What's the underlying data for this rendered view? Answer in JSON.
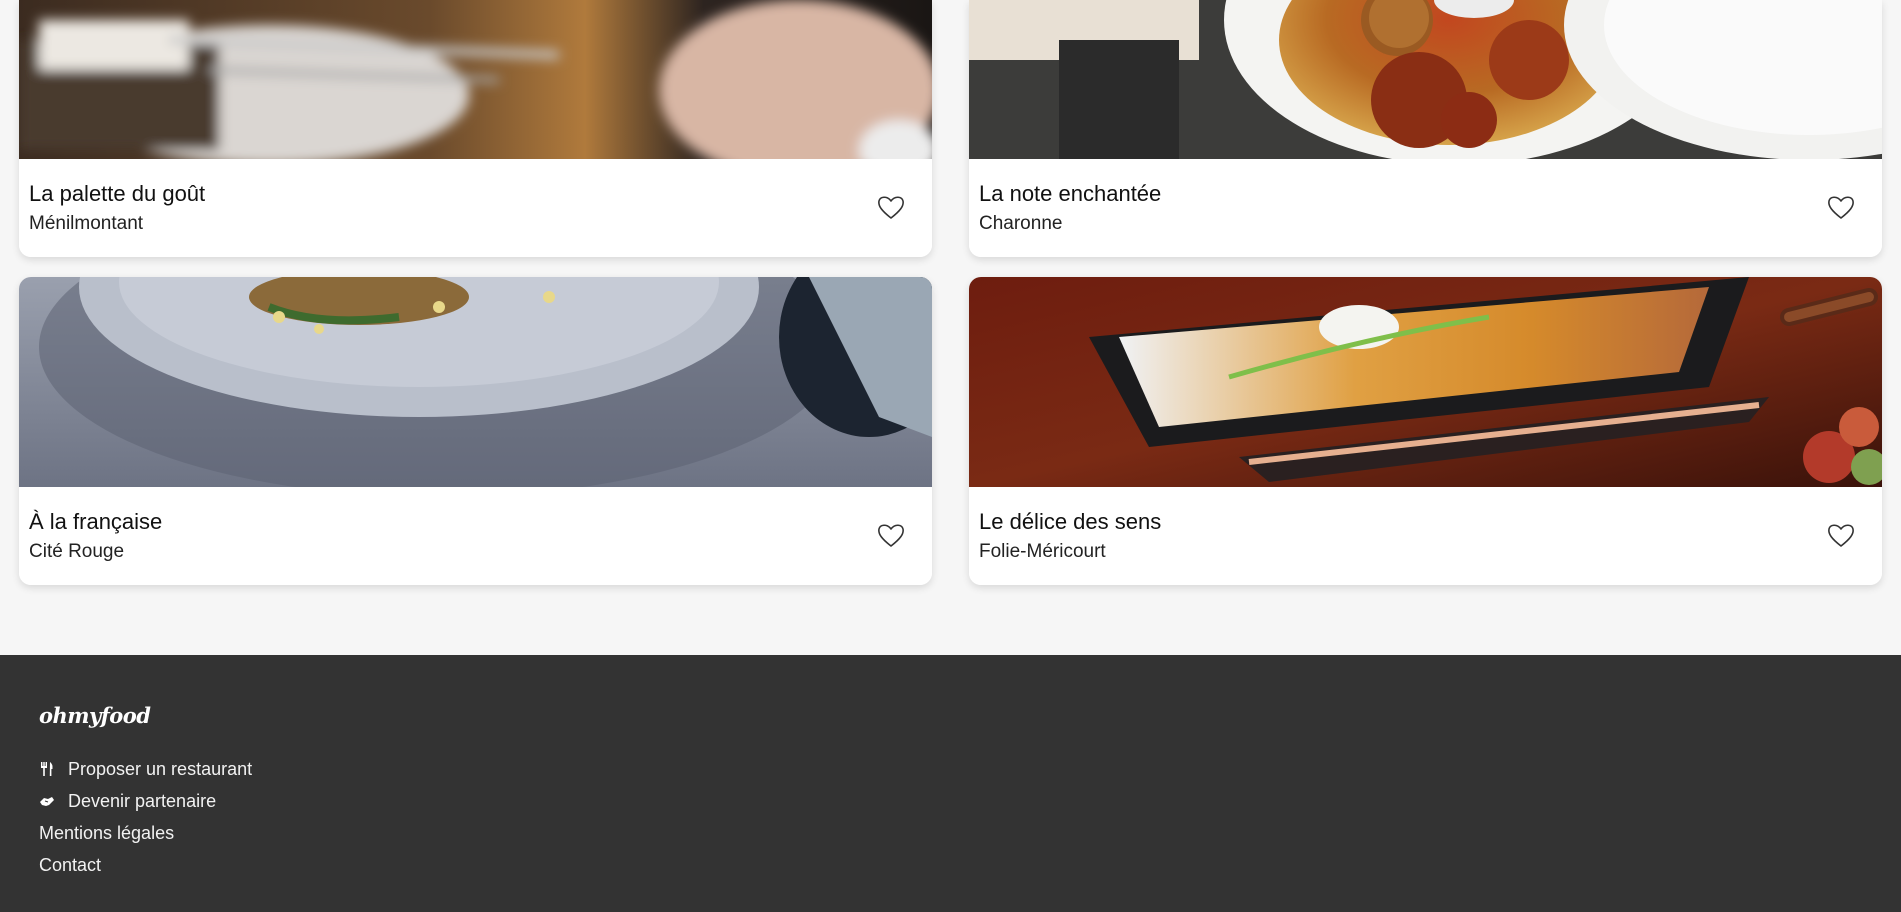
{
  "restaurants": [
    {
      "name": "La palette du goût",
      "location": "Ménilmontant",
      "favorite_icon": "heart-outline-icon"
    },
    {
      "name": "La note enchantée",
      "location": "Charonne",
      "favorite_icon": "heart-outline-icon"
    },
    {
      "name": "À la française",
      "location": "Cité Rouge",
      "favorite_icon": "heart-outline-icon"
    },
    {
      "name": "Le délice des sens",
      "location": "Folie-Méricourt",
      "favorite_icon": "heart-outline-icon"
    }
  ],
  "footer": {
    "brand": "ohmyfood",
    "links": [
      {
        "label": "Proposer un restaurant",
        "icon": "utensils-icon"
      },
      {
        "label": "Devenir partenaire",
        "icon": "handshake-icon"
      },
      {
        "label": "Mentions légales"
      },
      {
        "label": "Contact"
      }
    ]
  },
  "colors": {
    "page_background": "#f6f6f6",
    "card_background": "#ffffff",
    "footer_background": "#333333",
    "footer_text": "#ffffff"
  }
}
